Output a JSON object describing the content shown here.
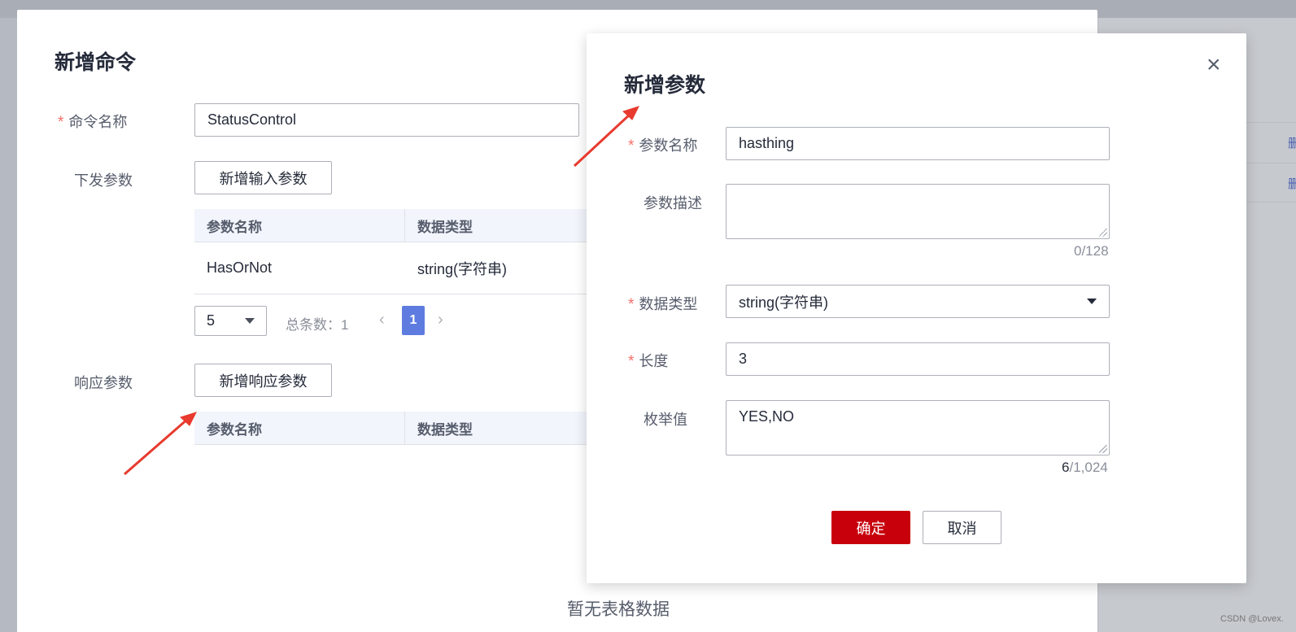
{
  "background": {
    "right_links": [
      "删",
      "删"
    ]
  },
  "watermark": "CSDN @Lovex.",
  "add_command_dialog": {
    "title": "新增命令",
    "command_name_label": "命令名称",
    "command_name_value": "StatusControl",
    "send_params_label": "下发参数",
    "add_input_param_button": "新增输入参数",
    "input_table": {
      "columns": [
        "参数名称",
        "数据类型"
      ],
      "rows": [
        {
          "name": "HasOrNot",
          "type": "string(字符串)"
        }
      ]
    },
    "pagination": {
      "page_size": "5",
      "total_label": "总条数：1",
      "current_page": "1"
    },
    "response_params_label": "响应参数",
    "add_response_param_button": "新增响应参数",
    "response_table": {
      "columns": [
        "参数名称",
        "数据类型"
      ]
    },
    "empty_text": "暂无表格数据"
  },
  "add_param_dialog": {
    "title": "新增参数",
    "param_name_label": "参数名称",
    "param_name_value": "hasthing",
    "param_desc_label": "参数描述",
    "param_desc_value": "",
    "param_desc_counter": "0/128",
    "data_type_label": "数据类型",
    "data_type_value": "string(字符串)",
    "length_label": "长度",
    "length_value": "3",
    "enum_label": "枚举值",
    "enum_value": "YES,NO",
    "enum_counter_current": "6",
    "enum_counter_max": "/1,024",
    "confirm_button": "确定",
    "cancel_button": "取消"
  },
  "colors": {
    "primary": "#c7000b",
    "page_active": "#5e7ce0",
    "required": "#f66f6a",
    "annotation_arrow": "#e83a2e"
  }
}
